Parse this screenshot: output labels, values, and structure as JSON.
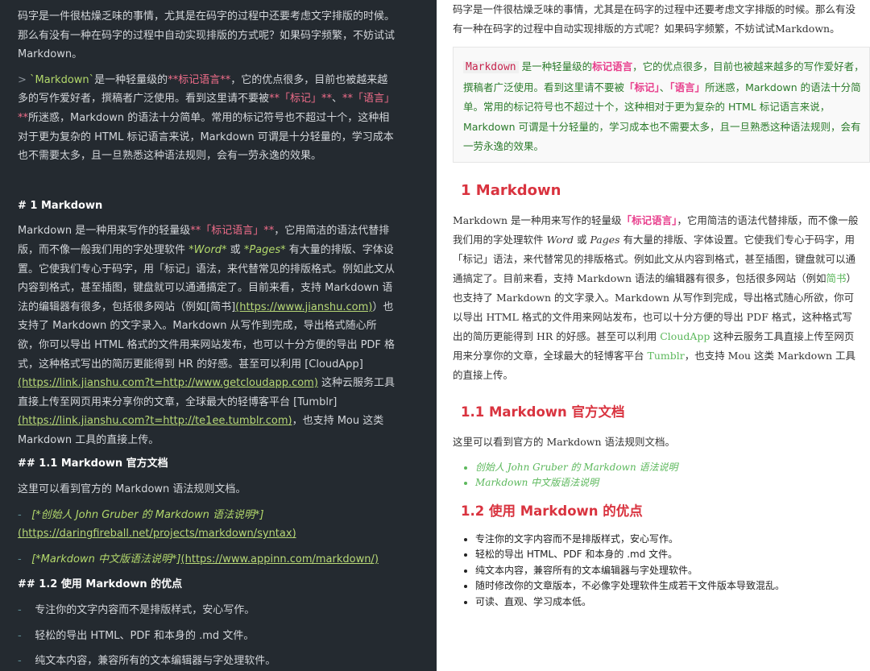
{
  "editor": {
    "intro": "码字是一件很枯燥乏味的事情，尤其是在码字的过程中还要考虑文字排版的时候。那么有没有一种在码字的过程中自动实现排版的方式呢？如果码字频繁，不妨试试Markdown。",
    "quote_marker": "> ",
    "quote_code": "`Markdown`",
    "quote_p1": "是一种轻量级的",
    "quote_bold": "**标记语言**",
    "quote_p2": "，它的优点很多，目前也被越来越多的写作爱好者，撰稿者广泛使用。看到这里请不要被",
    "quote_m1": "**「标记」**",
    "quote_sep": "、",
    "quote_m2": "**「语言」**",
    "quote_p3": "所迷惑，Markdown 的语法十分简单。常用的标记符号也不超过十个，这种相对于更为复杂的 HTML 标记语言来说，Markdown 可谓是十分轻量的，学习成本也不需要太多，且一旦熟悉这种语法规则，会有一劳永逸的效果。",
    "h1": "# 1 Markdown",
    "p1_a": "Markdown 是一种用来写作的轻量级",
    "p1_bold": "**「标记语言」**",
    "p1_b": "，它用简洁的语法代替排版，而不像一般我们用的字处理软件 ",
    "p1_word": "*Word*",
    "p1_or": " 或 ",
    "p1_pages": "*Pages*",
    "p1_c": " 有大量的排版、字体设置。它使我们专心于码字，用「标记」语法，来代替常见的排版格式。例如此文从内容到格式，甚至插图，键盘就可以通通搞定了。目前来看，支持 Markdown 语法的编辑器有很多，包括很多网站（例如[简书]",
    "p1_link1": "(https://www.jianshu.com)",
    "p1_d": "）也支持了 Markdown 的文字录入。Markdown 从写作到完成，导出格式随心所欲，你可以导出 HTML 格式的文件用来网站发布，也可以十分方便的导出 PDF 格式，这种格式写出的简历更能得到 HR 的好感。甚至可以利用 [CloudApp]",
    "p1_link2": "(https://link.jianshu.com?t=http://www.getcloudapp.com)",
    "p1_e": " 这种云服务工具直接上传至网页用来分享你的文章，全球最大的轻博客平台 [Tumblr]",
    "p1_link3": "(https://link.jianshu.com?t=http://te1ee.tumblr.com)",
    "p1_f": "，也支持 Mou 这类 Markdown 工具的直接上传。",
    "h2a": "## 1.1 Markdown 官方文档",
    "p2": "这里可以看到官方的 Markdown 语法规则文档。",
    "bullet": "-",
    "l1_text": "[*创始人 John Gruber 的 Markdown 语法说明*]",
    "l1_url": "(https://daringfireball.net/projects/markdown/syntax)",
    "l2_text": "[*Markdown 中文版语法说明*]",
    "l2_url": "(https://www.appinn.com/markdown/)",
    "h2b": "## 1.2 使用 Markdown 的优点",
    "adv": [
      "专注你的文字内容而不是排版样式，安心写作。",
      "轻松的导出 HTML、PDF 和本身的 .md 文件。",
      "纯文本内容，兼容所有的文本编辑器与字处理软件。"
    ]
  },
  "preview": {
    "intro": "码字是一件很枯燥乏味的事情，尤其是在码字的过程中还要考虑文字排版的时候。那么有没有一种在码字的过程中自动实现排版的方式呢？如果码字频繁，不妨试试Markdown。",
    "quote_code": "Markdown",
    "quote_p1": " 是一种轻量级的",
    "quote_bold": "标记语言",
    "quote_p2": "，它的优点很多，目前也被越来越多的写作爱好者，撰稿者广泛使用。看到这里请不要被",
    "quote_m1": "「标记」",
    "quote_sep": "、",
    "quote_m2": "「语言」",
    "quote_p3": "所迷惑，Markdown 的语法十分简单。常用的标记符号也不超过十个，这种相对于更为复杂的 HTML 标记语言来说，Markdown 可谓是十分轻量的，学习成本也不需要太多，且一旦熟悉这种语法规则，会有一劳永逸的效果。",
    "h1": "1 Markdown",
    "p1_a": "Markdown 是一种用来写作的轻量级",
    "p1_bold": "「标记语言」",
    "p1_b": "，它用简洁的语法代替排版，而不像一般我们用的字处理软件 ",
    "p1_word": "Word",
    "p1_or": " 或 ",
    "p1_pages": "Pages",
    "p1_c": " 有大量的排版、字体设置。它使我们专心于码字，用「标记」语法，来代替常见的排版格式。例如此文从内容到格式，甚至插图，键盘就可以通通搞定了。目前来看，支持 Markdown 语法的编辑器有很多，包括很多网站（例如",
    "p1_link1": "简书",
    "p1_d": "）也支持了 Markdown 的文字录入。Markdown 从写作到完成，导出格式随心所欲，你可以导出 HTML 格式的文件用来网站发布，也可以十分方便的导出 PDF 格式，这种格式写出的简历更能得到 HR 的好感。甚至可以利用 ",
    "p1_link2": "CloudApp",
    "p1_e": " 这种云服务工具直接上传至网页用来分享你的文章，全球最大的轻博客平台 ",
    "p1_link3": "Tumblr",
    "p1_f": "，也支持 Mou 这类 Markdown 工具的直接上传。",
    "h2a": "1.1 Markdown 官方文档",
    "p2": "这里可以看到官方的 Markdown 语法规则文档。",
    "links": [
      "创始人 John Gruber 的 Markdown 语法说明",
      "Markdown 中文版语法说明"
    ],
    "h2b": "1.2 使用 Markdown 的优点",
    "adv": [
      "专注你的文字内容而不是排版样式，安心写作。",
      "轻松的导出 HTML、PDF 和本身的 .md 文件。",
      "纯文本内容，兼容所有的文本编辑器与字处理软件。",
      "随时修改你的文章版本，不必像字处理软件生成若干文件版本导致混乱。",
      "可读、直观、学习成本低。"
    ]
  }
}
